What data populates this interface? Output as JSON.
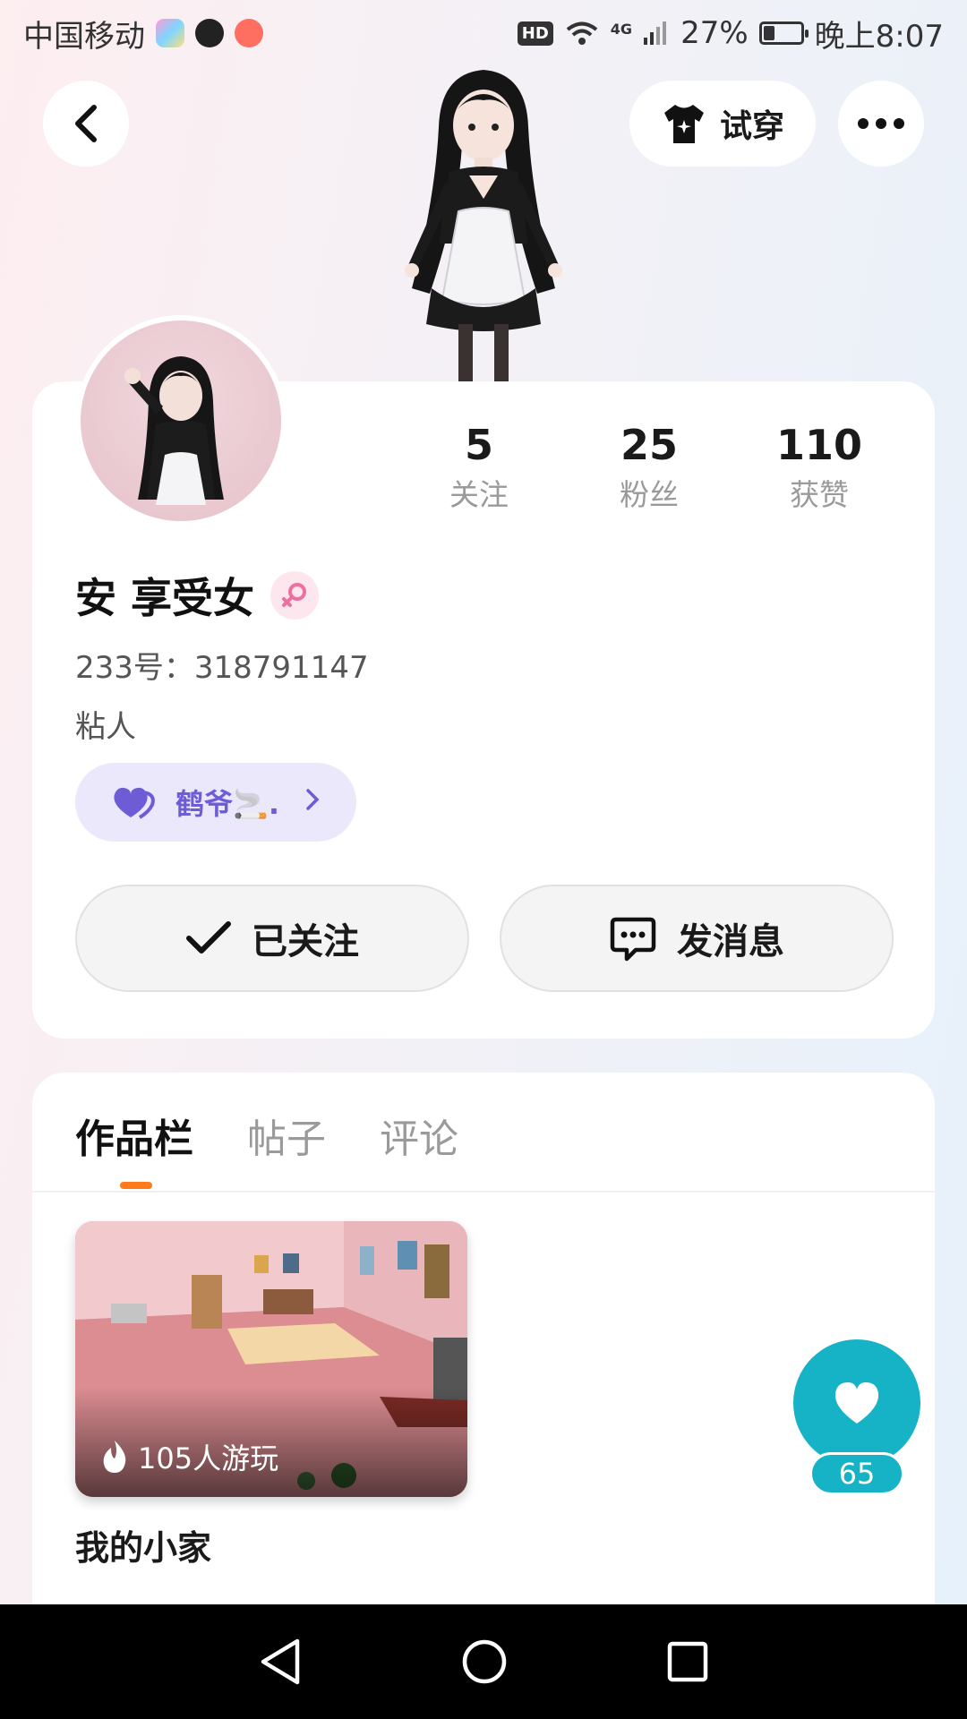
{
  "status_bar": {
    "carrier": "中国移动",
    "hd": "HD",
    "network": "4G",
    "battery": "27%",
    "battery_level": 0.27,
    "time": "晚上8:07"
  },
  "header": {
    "tryon_label": "试穿"
  },
  "profile": {
    "stats": [
      {
        "value": "5",
        "label": "关注"
      },
      {
        "value": "25",
        "label": "粉丝"
      },
      {
        "value": "110",
        "label": "获赞"
      }
    ],
    "username": "安 享受女",
    "uid": "233号：318791147",
    "bio": "粘人",
    "cp_name": "鹤爷🚬.",
    "follow_label": "已关注",
    "message_label": "发消息"
  },
  "works": {
    "tabs": [
      {
        "label": "作品栏",
        "active": true
      },
      {
        "label": "帖子",
        "active": false
      },
      {
        "label": "评论",
        "active": false
      }
    ],
    "items": [
      {
        "title": "我的小家",
        "plays": "105人游玩"
      }
    ]
  },
  "like": {
    "count": "65"
  },
  "colors": {
    "accent_teal": "#16b3c6",
    "tab_indicator": "#ff7a1a",
    "cp_purple": "#6d5cd6"
  }
}
